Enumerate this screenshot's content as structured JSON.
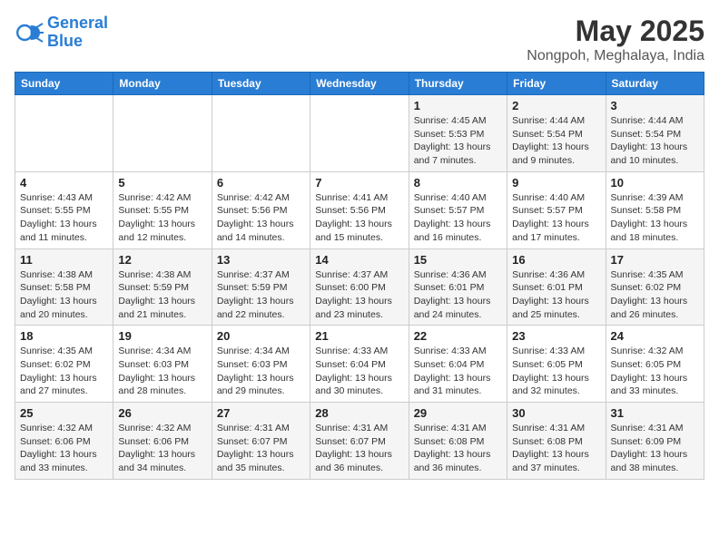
{
  "logo": {
    "line1": "General",
    "line2": "Blue"
  },
  "title": "May 2025",
  "location": "Nongpoh, Meghalaya, India",
  "weekdays": [
    "Sunday",
    "Monday",
    "Tuesday",
    "Wednesday",
    "Thursday",
    "Friday",
    "Saturday"
  ],
  "weeks": [
    [
      {
        "day": "",
        "info": ""
      },
      {
        "day": "",
        "info": ""
      },
      {
        "day": "",
        "info": ""
      },
      {
        "day": "",
        "info": ""
      },
      {
        "day": "1",
        "info": "Sunrise: 4:45 AM\nSunset: 5:53 PM\nDaylight: 13 hours\nand 7 minutes."
      },
      {
        "day": "2",
        "info": "Sunrise: 4:44 AM\nSunset: 5:54 PM\nDaylight: 13 hours\nand 9 minutes."
      },
      {
        "day": "3",
        "info": "Sunrise: 4:44 AM\nSunset: 5:54 PM\nDaylight: 13 hours\nand 10 minutes."
      }
    ],
    [
      {
        "day": "4",
        "info": "Sunrise: 4:43 AM\nSunset: 5:55 PM\nDaylight: 13 hours\nand 11 minutes."
      },
      {
        "day": "5",
        "info": "Sunrise: 4:42 AM\nSunset: 5:55 PM\nDaylight: 13 hours\nand 12 minutes."
      },
      {
        "day": "6",
        "info": "Sunrise: 4:42 AM\nSunset: 5:56 PM\nDaylight: 13 hours\nand 14 minutes."
      },
      {
        "day": "7",
        "info": "Sunrise: 4:41 AM\nSunset: 5:56 PM\nDaylight: 13 hours\nand 15 minutes."
      },
      {
        "day": "8",
        "info": "Sunrise: 4:40 AM\nSunset: 5:57 PM\nDaylight: 13 hours\nand 16 minutes."
      },
      {
        "day": "9",
        "info": "Sunrise: 4:40 AM\nSunset: 5:57 PM\nDaylight: 13 hours\nand 17 minutes."
      },
      {
        "day": "10",
        "info": "Sunrise: 4:39 AM\nSunset: 5:58 PM\nDaylight: 13 hours\nand 18 minutes."
      }
    ],
    [
      {
        "day": "11",
        "info": "Sunrise: 4:38 AM\nSunset: 5:58 PM\nDaylight: 13 hours\nand 20 minutes."
      },
      {
        "day": "12",
        "info": "Sunrise: 4:38 AM\nSunset: 5:59 PM\nDaylight: 13 hours\nand 21 minutes."
      },
      {
        "day": "13",
        "info": "Sunrise: 4:37 AM\nSunset: 5:59 PM\nDaylight: 13 hours\nand 22 minutes."
      },
      {
        "day": "14",
        "info": "Sunrise: 4:37 AM\nSunset: 6:00 PM\nDaylight: 13 hours\nand 23 minutes."
      },
      {
        "day": "15",
        "info": "Sunrise: 4:36 AM\nSunset: 6:01 PM\nDaylight: 13 hours\nand 24 minutes."
      },
      {
        "day": "16",
        "info": "Sunrise: 4:36 AM\nSunset: 6:01 PM\nDaylight: 13 hours\nand 25 minutes."
      },
      {
        "day": "17",
        "info": "Sunrise: 4:35 AM\nSunset: 6:02 PM\nDaylight: 13 hours\nand 26 minutes."
      }
    ],
    [
      {
        "day": "18",
        "info": "Sunrise: 4:35 AM\nSunset: 6:02 PM\nDaylight: 13 hours\nand 27 minutes."
      },
      {
        "day": "19",
        "info": "Sunrise: 4:34 AM\nSunset: 6:03 PM\nDaylight: 13 hours\nand 28 minutes."
      },
      {
        "day": "20",
        "info": "Sunrise: 4:34 AM\nSunset: 6:03 PM\nDaylight: 13 hours\nand 29 minutes."
      },
      {
        "day": "21",
        "info": "Sunrise: 4:33 AM\nSunset: 6:04 PM\nDaylight: 13 hours\nand 30 minutes."
      },
      {
        "day": "22",
        "info": "Sunrise: 4:33 AM\nSunset: 6:04 PM\nDaylight: 13 hours\nand 31 minutes."
      },
      {
        "day": "23",
        "info": "Sunrise: 4:33 AM\nSunset: 6:05 PM\nDaylight: 13 hours\nand 32 minutes."
      },
      {
        "day": "24",
        "info": "Sunrise: 4:32 AM\nSunset: 6:05 PM\nDaylight: 13 hours\nand 33 minutes."
      }
    ],
    [
      {
        "day": "25",
        "info": "Sunrise: 4:32 AM\nSunset: 6:06 PM\nDaylight: 13 hours\nand 33 minutes."
      },
      {
        "day": "26",
        "info": "Sunrise: 4:32 AM\nSunset: 6:06 PM\nDaylight: 13 hours\nand 34 minutes."
      },
      {
        "day": "27",
        "info": "Sunrise: 4:31 AM\nSunset: 6:07 PM\nDaylight: 13 hours\nand 35 minutes."
      },
      {
        "day": "28",
        "info": "Sunrise: 4:31 AM\nSunset: 6:07 PM\nDaylight: 13 hours\nand 36 minutes."
      },
      {
        "day": "29",
        "info": "Sunrise: 4:31 AM\nSunset: 6:08 PM\nDaylight: 13 hours\nand 36 minutes."
      },
      {
        "day": "30",
        "info": "Sunrise: 4:31 AM\nSunset: 6:08 PM\nDaylight: 13 hours\nand 37 minutes."
      },
      {
        "day": "31",
        "info": "Sunrise: 4:31 AM\nSunset: 6:09 PM\nDaylight: 13 hours\nand 38 minutes."
      }
    ]
  ]
}
